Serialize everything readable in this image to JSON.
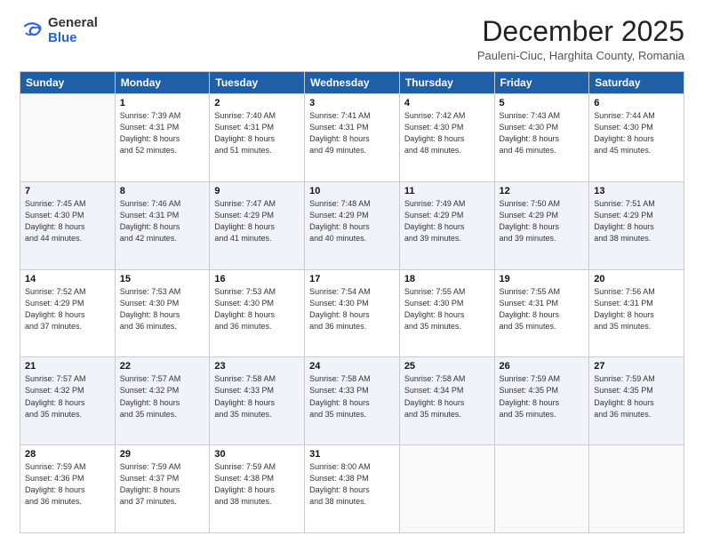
{
  "logo": {
    "general": "General",
    "blue": "Blue"
  },
  "title": "December 2025",
  "location": "Pauleni-Ciuc, Harghita County, Romania",
  "headers": [
    "Sunday",
    "Monday",
    "Tuesday",
    "Wednesday",
    "Thursday",
    "Friday",
    "Saturday"
  ],
  "weeks": [
    [
      {
        "day": "",
        "info": ""
      },
      {
        "day": "1",
        "info": "Sunrise: 7:39 AM\nSunset: 4:31 PM\nDaylight: 8 hours\nand 52 minutes."
      },
      {
        "day": "2",
        "info": "Sunrise: 7:40 AM\nSunset: 4:31 PM\nDaylight: 8 hours\nand 51 minutes."
      },
      {
        "day": "3",
        "info": "Sunrise: 7:41 AM\nSunset: 4:31 PM\nDaylight: 8 hours\nand 49 minutes."
      },
      {
        "day": "4",
        "info": "Sunrise: 7:42 AM\nSunset: 4:30 PM\nDaylight: 8 hours\nand 48 minutes."
      },
      {
        "day": "5",
        "info": "Sunrise: 7:43 AM\nSunset: 4:30 PM\nDaylight: 8 hours\nand 46 minutes."
      },
      {
        "day": "6",
        "info": "Sunrise: 7:44 AM\nSunset: 4:30 PM\nDaylight: 8 hours\nand 45 minutes."
      }
    ],
    [
      {
        "day": "7",
        "info": "Sunrise: 7:45 AM\nSunset: 4:30 PM\nDaylight: 8 hours\nand 44 minutes."
      },
      {
        "day": "8",
        "info": "Sunrise: 7:46 AM\nSunset: 4:31 PM\nDaylight: 8 hours\nand 42 minutes."
      },
      {
        "day": "9",
        "info": "Sunrise: 7:47 AM\nSunset: 4:29 PM\nDaylight: 8 hours\nand 41 minutes."
      },
      {
        "day": "10",
        "info": "Sunrise: 7:48 AM\nSunset: 4:29 PM\nDaylight: 8 hours\nand 40 minutes."
      },
      {
        "day": "11",
        "info": "Sunrise: 7:49 AM\nSunset: 4:29 PM\nDaylight: 8 hours\nand 39 minutes."
      },
      {
        "day": "12",
        "info": "Sunrise: 7:50 AM\nSunset: 4:29 PM\nDaylight: 8 hours\nand 39 minutes."
      },
      {
        "day": "13",
        "info": "Sunrise: 7:51 AM\nSunset: 4:29 PM\nDaylight: 8 hours\nand 38 minutes."
      }
    ],
    [
      {
        "day": "14",
        "info": "Sunrise: 7:52 AM\nSunset: 4:29 PM\nDaylight: 8 hours\nand 37 minutes."
      },
      {
        "day": "15",
        "info": "Sunrise: 7:53 AM\nSunset: 4:30 PM\nDaylight: 8 hours\nand 36 minutes."
      },
      {
        "day": "16",
        "info": "Sunrise: 7:53 AM\nSunset: 4:30 PM\nDaylight: 8 hours\nand 36 minutes."
      },
      {
        "day": "17",
        "info": "Sunrise: 7:54 AM\nSunset: 4:30 PM\nDaylight: 8 hours\nand 36 minutes."
      },
      {
        "day": "18",
        "info": "Sunrise: 7:55 AM\nSunset: 4:30 PM\nDaylight: 8 hours\nand 35 minutes."
      },
      {
        "day": "19",
        "info": "Sunrise: 7:55 AM\nSunset: 4:31 PM\nDaylight: 8 hours\nand 35 minutes."
      },
      {
        "day": "20",
        "info": "Sunrise: 7:56 AM\nSunset: 4:31 PM\nDaylight: 8 hours\nand 35 minutes."
      }
    ],
    [
      {
        "day": "21",
        "info": "Sunrise: 7:57 AM\nSunset: 4:32 PM\nDaylight: 8 hours\nand 35 minutes."
      },
      {
        "day": "22",
        "info": "Sunrise: 7:57 AM\nSunset: 4:32 PM\nDaylight: 8 hours\nand 35 minutes."
      },
      {
        "day": "23",
        "info": "Sunrise: 7:58 AM\nSunset: 4:33 PM\nDaylight: 8 hours\nand 35 minutes."
      },
      {
        "day": "24",
        "info": "Sunrise: 7:58 AM\nSunset: 4:33 PM\nDaylight: 8 hours\nand 35 minutes."
      },
      {
        "day": "25",
        "info": "Sunrise: 7:58 AM\nSunset: 4:34 PM\nDaylight: 8 hours\nand 35 minutes."
      },
      {
        "day": "26",
        "info": "Sunrise: 7:59 AM\nSunset: 4:35 PM\nDaylight: 8 hours\nand 35 minutes."
      },
      {
        "day": "27",
        "info": "Sunrise: 7:59 AM\nSunset: 4:35 PM\nDaylight: 8 hours\nand 36 minutes."
      }
    ],
    [
      {
        "day": "28",
        "info": "Sunrise: 7:59 AM\nSunset: 4:36 PM\nDaylight: 8 hours\nand 36 minutes."
      },
      {
        "day": "29",
        "info": "Sunrise: 7:59 AM\nSunset: 4:37 PM\nDaylight: 8 hours\nand 37 minutes."
      },
      {
        "day": "30",
        "info": "Sunrise: 7:59 AM\nSunset: 4:38 PM\nDaylight: 8 hours\nand 38 minutes."
      },
      {
        "day": "31",
        "info": "Sunrise: 8:00 AM\nSunset: 4:38 PM\nDaylight: 8 hours\nand 38 minutes."
      },
      {
        "day": "",
        "info": ""
      },
      {
        "day": "",
        "info": ""
      },
      {
        "day": "",
        "info": ""
      }
    ]
  ]
}
